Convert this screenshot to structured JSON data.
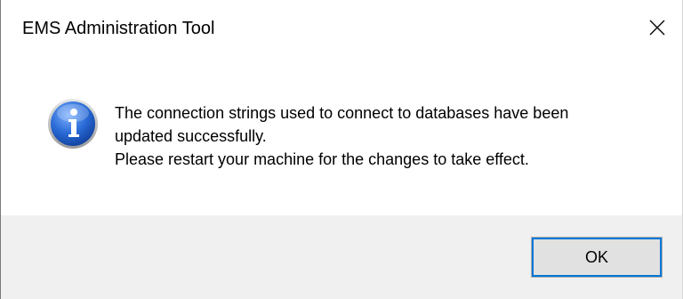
{
  "dialog": {
    "title": "EMS Administration Tool",
    "message_lines": [
      "The connection strings used to connect to databases have been",
      "updated successfully.",
      "Please restart your machine for the changes to take effect."
    ],
    "ok_label": "OK",
    "icon": "info-icon",
    "close_icon": "close-icon"
  },
  "colors": {
    "footer_bg": "#f0f0f0",
    "button_bg": "#e1e1e1",
    "button_focus": "#0078d7",
    "icon_blue": "#1f5fbf"
  }
}
